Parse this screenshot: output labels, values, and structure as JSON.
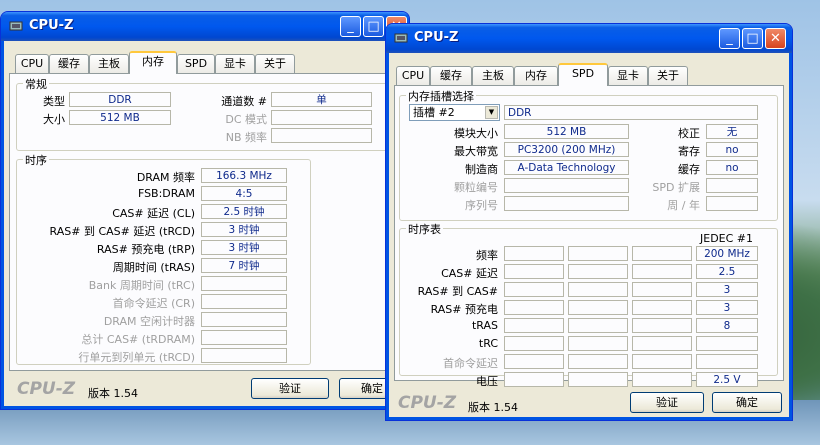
{
  "app_name": "CPU-Z",
  "version_label": "版本 1.54",
  "brand": "CPU-Z",
  "buttons": {
    "validate": "验证",
    "ok": "确定"
  },
  "titlebar_buttons": {
    "minimize": "_",
    "maximize": "□",
    "close": "✕"
  },
  "tabs": [
    "CPU",
    "缓存",
    "主板",
    "内存",
    "SPD",
    "显卡",
    "关于"
  ],
  "memory": {
    "general": {
      "title": "常规",
      "type_label": "类型",
      "type_value": "DDR",
      "size_label": "大小",
      "size_value": "512 MB",
      "channels_label": "通道数 #",
      "channels_value": "单",
      "dc_mode_label": "DC 模式",
      "dc_mode_value": "",
      "nb_freq_label": "NB 频率",
      "nb_freq_value": ""
    },
    "timings": {
      "title": "时序",
      "rows": [
        {
          "label": "DRAM 频率",
          "value": "166.3 MHz",
          "dim": false
        },
        {
          "label": "FSB:DRAM",
          "value": "4:5",
          "dim": false
        },
        {
          "label": "CAS# 延迟 (CL)",
          "value": "2.5 时钟",
          "dim": false
        },
        {
          "label": "RAS# 到 CAS# 延迟 (tRCD)",
          "value": "3 时钟",
          "dim": false
        },
        {
          "label": "RAS# 预充电 (tRP)",
          "value": "3 时钟",
          "dim": false
        },
        {
          "label": "周期时间 (tRAS)",
          "value": "7 时钟",
          "dim": false
        },
        {
          "label": "Bank 周期时间 (tRC)",
          "value": "",
          "dim": true
        },
        {
          "label": "首命令延迟 (CR)",
          "value": "",
          "dim": true
        },
        {
          "label": "DRAM 空闲计时器",
          "value": "",
          "dim": true
        },
        {
          "label": "总计 CAS# (tRDRAM)",
          "value": "",
          "dim": true
        },
        {
          "label": "行单元到列单元 (tRCD)",
          "value": "",
          "dim": true
        }
      ]
    }
  },
  "spd": {
    "slot_group_title": "内存插槽选择",
    "slot_select": "插槽 #2",
    "slot_type": "DDR",
    "module_size_label": "模块大小",
    "module_size": "512 MB",
    "max_bw_label": "最大带宽",
    "max_bw": "PC3200 (200 MHz)",
    "manufacturer_label": "制造商",
    "manufacturer": "A-Data Technology",
    "part_label": "颗粒编号",
    "part": "",
    "serial_label": "序列号",
    "serial": "",
    "correction_label": "校正",
    "correction": "无",
    "registered_label": "寄存",
    "registered": "no",
    "buffered_label": "缓存",
    "buffered": "no",
    "spd_ext_label": "SPD 扩展",
    "spd_ext": "",
    "week_year_label": "周 / 年",
    "week_year": "",
    "timing_table_title": "时序表",
    "jedec_header": "JEDEC #1",
    "timing_rows": [
      {
        "label": "频率",
        "value": "200 MHz",
        "dim": false
      },
      {
        "label": "CAS# 延迟",
        "value": "2.5",
        "dim": false
      },
      {
        "label": "RAS# 到 CAS#",
        "value": "3",
        "dim": false
      },
      {
        "label": "RAS# 预充电",
        "value": "3",
        "dim": false
      },
      {
        "label": "tRAS",
        "value": "8",
        "dim": false
      },
      {
        "label": "tRC",
        "value": "",
        "dim": false
      },
      {
        "label": "首命令延迟",
        "value": "",
        "dim": true
      },
      {
        "label": "电压",
        "value": "2.5 V",
        "dim": false
      }
    ]
  },
  "colors": {
    "title_blue": "#0058ee",
    "value_text": "#0f2a8c",
    "active_tab_accent": "#ffc83c"
  }
}
